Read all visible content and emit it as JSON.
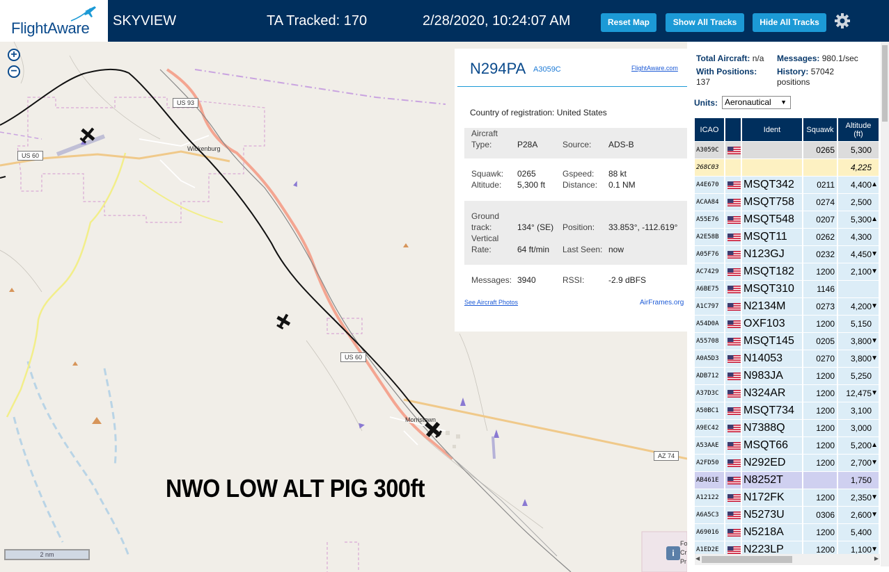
{
  "header": {
    "logo_text": "FlightAware",
    "app_title": "SKYVIEW",
    "ta_tracked": "TA Tracked: 170",
    "clock": "2/28/2020, 10:24:07 AM",
    "reset_map": "Reset Map",
    "show_all_tracks": "Show All Tracks",
    "hide_all_tracks": "Hide All Tracks",
    "settings_icon": "gear-icon",
    "brand_color": "#002f5d",
    "button_color": "#1c9ad6"
  },
  "map": {
    "zoom_in": "+",
    "zoom_out": "−",
    "scale_label": "2 nm",
    "overlay_text": "NWO LOW ALT PIG 300ft",
    "info_button": "i",
    "labels": {
      "wickenburg": "Wickenburg",
      "morristown": "Morristown",
      "us93": "US 93",
      "us60_west": "US 60",
      "us60_south": "US 60",
      "az74": "AZ 74",
      "edge1": "Fo",
      "edge2": "Cr",
      "edge3": "Pr"
    }
  },
  "popup": {
    "callsign": "N294PA",
    "hex": "A3059C",
    "flightaware_link": "FlightAware.com",
    "country_label": "Country of registration:",
    "country_value": "United States",
    "aircraft_type_label_1": "Aircraft",
    "aircraft_type_label_2": "Type:",
    "aircraft_type_value": "P28A",
    "source_label": "Source:",
    "source_value": "ADS-B",
    "squawk_label": "Squawk:",
    "squawk_value": "0265",
    "gspeed_label": "Gspeed:",
    "gspeed_value": "88 kt",
    "altitude_label": "Altitude:",
    "altitude_value": "5,300 ft",
    "distance_label": "Distance:",
    "distance_value": "0.1 NM",
    "ground_track_label_1": "Ground",
    "ground_track_label_2": "track:",
    "ground_track_value": "134° (SE)",
    "position_label": "Position:",
    "position_value": "33.853°, -112.619°",
    "vertical_rate_label_1": "Vertical",
    "vertical_rate_label_2": "Rate:",
    "vertical_rate_value": "64 ft/min",
    "last_seen_label": "Last Seen:",
    "last_seen_value": "now",
    "messages_label": "Messages:",
    "messages_value": "3940",
    "rssi_label": "RSSI:",
    "rssi_value": "-2.9 dBFS",
    "see_photos": "See Aircraft Photos",
    "airframes": "AirFrames.org"
  },
  "sidebar": {
    "total_aircraft_label": "Total Aircraft:",
    "total_aircraft_value": "n/a",
    "messages_label": "Messages:",
    "messages_value": "980.1/sec",
    "with_positions_label": "With Positions:",
    "with_positions_value": "137",
    "history_label": "History:",
    "history_value": "57042",
    "history_unit": "positions",
    "units_label": "Units:",
    "units_value": "Aeronautical",
    "columns": {
      "icao": "ICAO",
      "ident": "Ident",
      "squawk": "Squawk",
      "altitude_1": "Altitude",
      "altitude_2": "(ft)"
    },
    "rows": [
      {
        "icao": "A3059C",
        "ident": "",
        "squawk": "0265",
        "alt": "5,300",
        "arrow": "",
        "flag": true,
        "style": "selected"
      },
      {
        "icao": "268C03",
        "ident": "",
        "squawk": "",
        "alt": "4,225",
        "arrow": "",
        "flag": false,
        "style": "mlat"
      },
      {
        "icao": "A4E670",
        "ident": "MSQT342",
        "squawk": "0211",
        "alt": "4,400",
        "arrow": "▲",
        "flag": true,
        "style": "normal"
      },
      {
        "icao": "ACAA84",
        "ident": "MSQT758",
        "squawk": "0274",
        "alt": "2,500",
        "arrow": "",
        "flag": true,
        "style": "normal"
      },
      {
        "icao": "A55E76",
        "ident": "MSQT548",
        "squawk": "0207",
        "alt": "5,300",
        "arrow": "▲",
        "flag": true,
        "style": "normal"
      },
      {
        "icao": "A2E58B",
        "ident": "MSQT11",
        "squawk": "0262",
        "alt": "4,300",
        "arrow": "",
        "flag": true,
        "style": "normal"
      },
      {
        "icao": "A05F76",
        "ident": "N123GJ",
        "squawk": "0232",
        "alt": "4,450",
        "arrow": "▼",
        "flag": true,
        "style": "normal"
      },
      {
        "icao": "AC7429",
        "ident": "MSQT182",
        "squawk": "1200",
        "alt": "2,100",
        "arrow": "▼",
        "flag": true,
        "style": "normal"
      },
      {
        "icao": "A6BE75",
        "ident": "MSQT310",
        "squawk": "1146",
        "alt": "",
        "arrow": "",
        "flag": true,
        "style": "normal"
      },
      {
        "icao": "A1C797",
        "ident": "N2134M",
        "squawk": "0273",
        "alt": "4,200",
        "arrow": "▼",
        "flag": true,
        "style": "normal"
      },
      {
        "icao": "A54D0A",
        "ident": "OXF103",
        "squawk": "1200",
        "alt": "5,150",
        "arrow": "",
        "flag": true,
        "style": "normal"
      },
      {
        "icao": "A55708",
        "ident": "MSQT145",
        "squawk": "0205",
        "alt": "3,800",
        "arrow": "▼",
        "flag": true,
        "style": "normal"
      },
      {
        "icao": "A0A5D3",
        "ident": "N14053",
        "squawk": "0270",
        "alt": "3,800",
        "arrow": "▼",
        "flag": true,
        "style": "normal"
      },
      {
        "icao": "ADB712",
        "ident": "N983JA",
        "squawk": "1200",
        "alt": "5,250",
        "arrow": "",
        "flag": true,
        "style": "normal"
      },
      {
        "icao": "A37D3C",
        "ident": "N324AR",
        "squawk": "1200",
        "alt": "12,475",
        "arrow": "▼",
        "flag": true,
        "style": "normal"
      },
      {
        "icao": "A50BC1",
        "ident": "MSQT734",
        "squawk": "1200",
        "alt": "3,100",
        "arrow": "",
        "flag": true,
        "style": "normal"
      },
      {
        "icao": "A9EC42",
        "ident": "N7388Q",
        "squawk": "1200",
        "alt": "3,000",
        "arrow": "",
        "flag": true,
        "style": "normal"
      },
      {
        "icao": "A53AAE",
        "ident": "MSQT66",
        "squawk": "1200",
        "alt": "5,200",
        "arrow": "▲",
        "flag": true,
        "style": "normal"
      },
      {
        "icao": "A2FD50",
        "ident": "N292ED",
        "squawk": "1200",
        "alt": "2,700",
        "arrow": "▼",
        "flag": true,
        "style": "normal"
      },
      {
        "icao": "AB461E",
        "ident": "N8252T",
        "squawk": "",
        "alt": "1,750",
        "arrow": "",
        "flag": true,
        "style": "stale"
      },
      {
        "icao": "A12122",
        "ident": "N172FK",
        "squawk": "1200",
        "alt": "2,350",
        "arrow": "▼",
        "flag": true,
        "style": "normal"
      },
      {
        "icao": "A6A5C3",
        "ident": "N5273U",
        "squawk": "0306",
        "alt": "2,600",
        "arrow": "▼",
        "flag": true,
        "style": "normal"
      },
      {
        "icao": "A69016",
        "ident": "N5218A",
        "squawk": "1200",
        "alt": "5,400",
        "arrow": "",
        "flag": true,
        "style": "normal"
      },
      {
        "icao": "A1ED2E",
        "ident": "N223LP",
        "squawk": "1200",
        "alt": "1,100",
        "arrow": "▼",
        "flag": true,
        "style": "normal"
      }
    ]
  }
}
